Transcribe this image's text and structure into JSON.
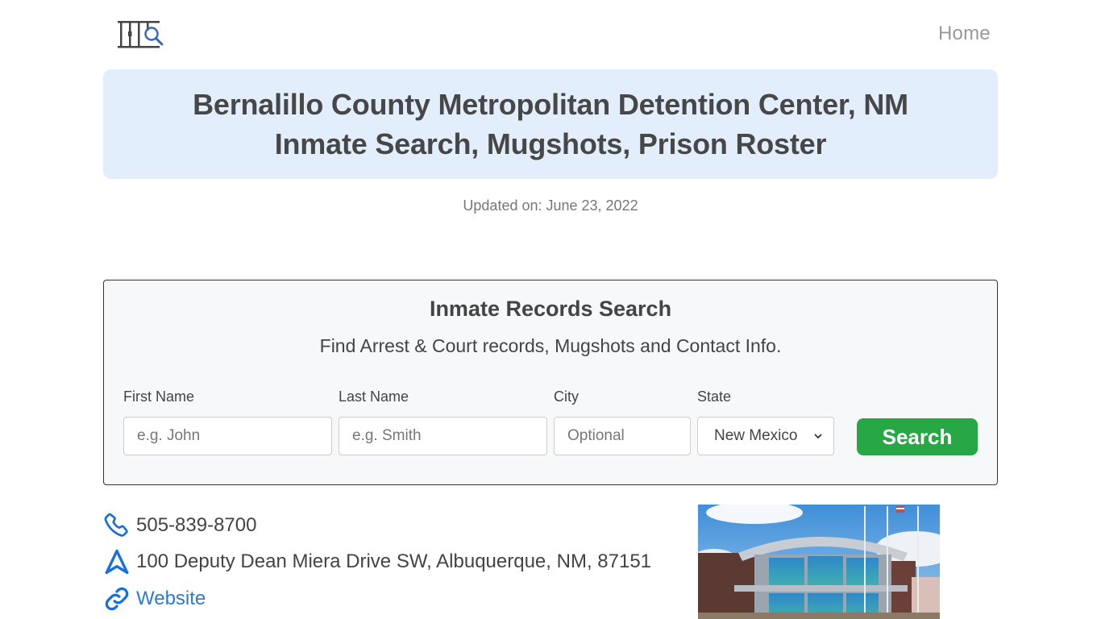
{
  "navbar": {
    "logo_icon": "jail-bars-search-icon",
    "home_label": "Home"
  },
  "hero": {
    "title_line1": "Bernalillo County Metropolitan Detention Center, NM",
    "title_line2": "Inmate Search, Mugshots, Prison Roster"
  },
  "updated": "Updated on: June 23, 2022",
  "search": {
    "title": "Inmate Records Search",
    "subtitle": "Find Arrest & Court records, Mugshots and Contact Info.",
    "fields": [
      {
        "label": "First Name",
        "placeholder": "e.g. John",
        "value": ""
      },
      {
        "label": "Last Name",
        "placeholder": "e.g. Smith",
        "value": ""
      },
      {
        "label": "City",
        "placeholder": "Optional",
        "value": ""
      }
    ],
    "state": {
      "label": "State",
      "selected": "New Mexico"
    },
    "button_label": "Search",
    "button_color": "#28a745"
  },
  "contact": {
    "phone": "505-839-8700",
    "address": "100 Deputy Dean Miera Drive SW, Albuquerque, NM, 87151",
    "website_label": "Website",
    "icon_color": "#1a6fe0"
  },
  "photo": {
    "alt": "Bernalillo County Metropolitan Detention Center building"
  }
}
